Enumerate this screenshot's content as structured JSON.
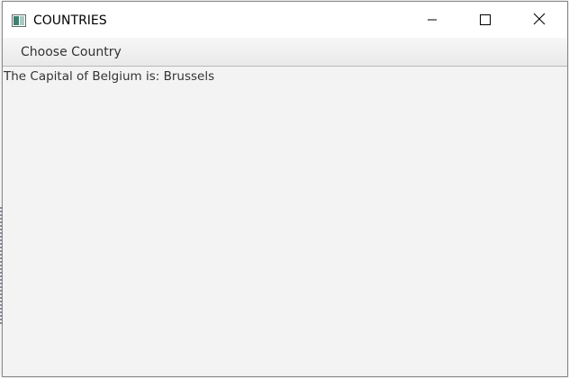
{
  "window": {
    "title": "COUNTRIES",
    "icon": "app-window-icon"
  },
  "controls": {
    "minimize_icon": "minimize-icon",
    "maximize_icon": "maximize-icon",
    "close_icon": "close-icon"
  },
  "menubar": {
    "items": [
      {
        "label": "Choose Country"
      }
    ]
  },
  "content": {
    "capital_text": "The Capital of Belgium is: Brussels"
  },
  "colors": {
    "window_bg": "#f3f3f3",
    "titlebar_bg": "#ffffff",
    "text": "#333333"
  }
}
